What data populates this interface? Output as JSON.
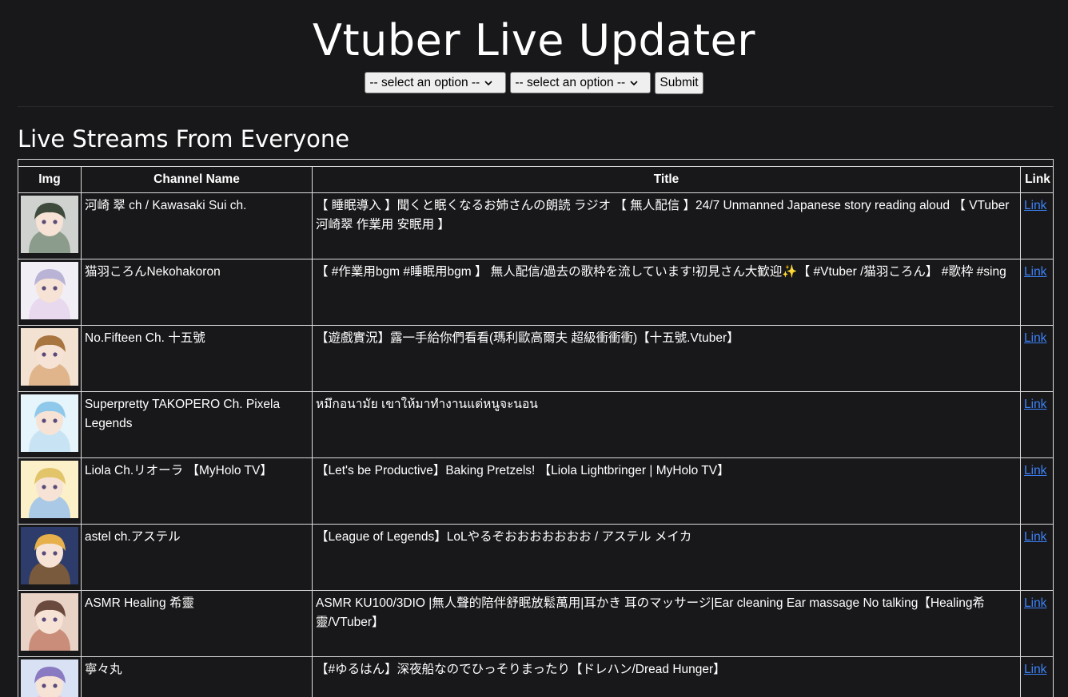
{
  "header": {
    "title": "Vtuber Live Updater",
    "select_1": "-- select an option --",
    "select_2": "-- select an option --",
    "submit_label": "Submit"
  },
  "section_title": "Live Streams From Everyone",
  "table": {
    "columns": [
      "Img",
      "Channel Name",
      "Title",
      "Link"
    ],
    "rows": [
      {
        "channel": "河崎 翠 ch / Kawasaki Sui ch.",
        "title": "【 睡眠導入 】聞くと眠くなるお姉さんの朗読 ラジオ 【 無人配信 】24/7 Unmanned Japanese story reading aloud 【 VTuber 河崎翠 作業用 安眠用 】",
        "link": "Link",
        "avatar_colors": [
          "#cfd2cf",
          "#3d4a3c",
          "#8c9c8c"
        ]
      },
      {
        "channel": "猫羽ころんNekohakoron",
        "title": "【 #作業用bgm #睡眠用bgm 】 無人配信/過去の歌枠を流しています!初見さん大歓迎✨【 #Vtuber /猫羽ころん】 #歌枠 #sing",
        "link": "Link",
        "avatar_colors": [
          "#f2eef6",
          "#b9b3d6",
          "#e8d9ee"
        ]
      },
      {
        "channel": "No.Fifteen Ch. 十五號",
        "title": "【遊戲實況】露一手給你們看看(瑪利歐高爾夫 超級衝衝衝)【十五號.Vtuber】",
        "link": "Link",
        "avatar_colors": [
          "#f3e2d2",
          "#a8743f",
          "#e0b58c"
        ]
      },
      {
        "channel": "Superpretty TAKOPERO Ch. Pixela Legends",
        "title": "หมึกอนามัย เขาให้มาทำงานแต่หนูจะนอน",
        "link": "Link",
        "avatar_colors": [
          "#e6f4fb",
          "#8ec8ea",
          "#c8e4f4"
        ]
      },
      {
        "channel": "Liola Ch.リオーラ 【MyHolo TV】",
        "title": "【Let's be Productive】Baking Pretzels! 【Liola Lightbringer | MyHolo TV】",
        "link": "Link",
        "avatar_colors": [
          "#fbf0c8",
          "#e2c56a",
          "#a9c9e6"
        ]
      },
      {
        "channel": "astel ch.アステル",
        "title": "【League of Legends】LoLやるぞおおおおおおお / アステル メイカ",
        "link": "Link",
        "avatar_colors": [
          "#2d3c6b",
          "#e7b04a",
          "#7a5a3c"
        ]
      },
      {
        "channel": "ASMR Healing 希靈",
        "title": "ASMR KU100/3DIO |無人聲的陪伴舒眠放鬆萬用|耳かき 耳のマッサージ|Ear cleaning Ear massage No talking【Healing希靈/VTuber】",
        "link": "Link",
        "avatar_colors": [
          "#e9d2c6",
          "#6b4a3e",
          "#c98d7a"
        ]
      },
      {
        "channel": "寧々丸",
        "title": "【#ゆるはん】深夜船なのでひっそりまったり【ドレハン/Dread Hunger】",
        "link": "Link",
        "avatar_colors": [
          "#d9e2f4",
          "#8a7ac2",
          "#f0c6d8"
        ]
      }
    ]
  }
}
